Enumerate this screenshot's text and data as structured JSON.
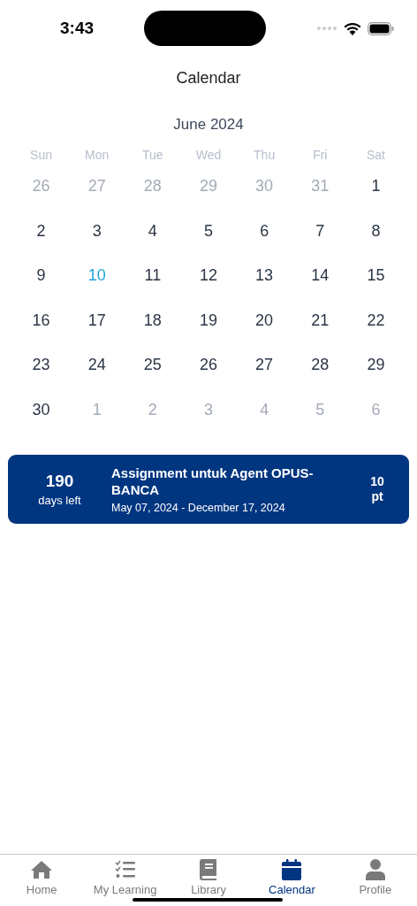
{
  "status_bar": {
    "time": "3:43"
  },
  "header": {
    "title": "Calendar"
  },
  "calendar": {
    "month": "June 2024",
    "weekdays": [
      "Sun",
      "Mon",
      "Tue",
      "Wed",
      "Thu",
      "Fri",
      "Sat"
    ],
    "weeks": [
      [
        {
          "day": "26",
          "outside": true,
          "selected": false
        },
        {
          "day": "27",
          "outside": true,
          "selected": false
        },
        {
          "day": "28",
          "outside": true,
          "selected": false
        },
        {
          "day": "29",
          "outside": true,
          "selected": false
        },
        {
          "day": "30",
          "outside": true,
          "selected": false
        },
        {
          "day": "31",
          "outside": true,
          "selected": false
        },
        {
          "day": "1",
          "outside": false,
          "selected": false
        }
      ],
      [
        {
          "day": "2",
          "outside": false,
          "selected": false
        },
        {
          "day": "3",
          "outside": false,
          "selected": false
        },
        {
          "day": "4",
          "outside": false,
          "selected": false
        },
        {
          "day": "5",
          "outside": false,
          "selected": false
        },
        {
          "day": "6",
          "outside": false,
          "selected": false
        },
        {
          "day": "7",
          "outside": false,
          "selected": false
        },
        {
          "day": "8",
          "outside": false,
          "selected": false
        }
      ],
      [
        {
          "day": "9",
          "outside": false,
          "selected": false
        },
        {
          "day": "10",
          "outside": false,
          "selected": true
        },
        {
          "day": "11",
          "outside": false,
          "selected": false
        },
        {
          "day": "12",
          "outside": false,
          "selected": false
        },
        {
          "day": "13",
          "outside": false,
          "selected": false
        },
        {
          "day": "14",
          "outside": false,
          "selected": false
        },
        {
          "day": "15",
          "outside": false,
          "selected": false
        }
      ],
      [
        {
          "day": "16",
          "outside": false,
          "selected": false
        },
        {
          "day": "17",
          "outside": false,
          "selected": false
        },
        {
          "day": "18",
          "outside": false,
          "selected": false
        },
        {
          "day": "19",
          "outside": false,
          "selected": false
        },
        {
          "day": "20",
          "outside": false,
          "selected": false
        },
        {
          "day": "21",
          "outside": false,
          "selected": false
        },
        {
          "day": "22",
          "outside": false,
          "selected": false
        }
      ],
      [
        {
          "day": "23",
          "outside": false,
          "selected": false
        },
        {
          "day": "24",
          "outside": false,
          "selected": false
        },
        {
          "day": "25",
          "outside": false,
          "selected": false
        },
        {
          "day": "26",
          "outside": false,
          "selected": false
        },
        {
          "day": "27",
          "outside": false,
          "selected": false
        },
        {
          "day": "28",
          "outside": false,
          "selected": false
        },
        {
          "day": "29",
          "outside": false,
          "selected": false
        }
      ],
      [
        {
          "day": "30",
          "outside": false,
          "selected": false
        },
        {
          "day": "1",
          "outside": true,
          "selected": false
        },
        {
          "day": "2",
          "outside": true,
          "selected": false
        },
        {
          "day": "3",
          "outside": true,
          "selected": false
        },
        {
          "day": "4",
          "outside": true,
          "selected": false
        },
        {
          "day": "5",
          "outside": true,
          "selected": false
        },
        {
          "day": "6",
          "outside": true,
          "selected": false
        }
      ]
    ]
  },
  "assignments": [
    {
      "days": "190",
      "days_label": "days left",
      "title": "Assignment untuk Agent OPUS-BANCA",
      "dates": "May 07, 2024 - December 17, 2024",
      "points": "10",
      "points_unit": "pt"
    }
  ],
  "tab_bar": [
    {
      "kind": "home",
      "label": "Home",
      "selected": false
    },
    {
      "kind": "list",
      "label": "My Learning",
      "selected": false
    },
    {
      "kind": "book",
      "label": "Library",
      "selected": false
    },
    {
      "kind": "calendar",
      "label": "Calendar",
      "selected": true
    },
    {
      "kind": "person",
      "label": "Profile",
      "selected": false
    }
  ]
}
